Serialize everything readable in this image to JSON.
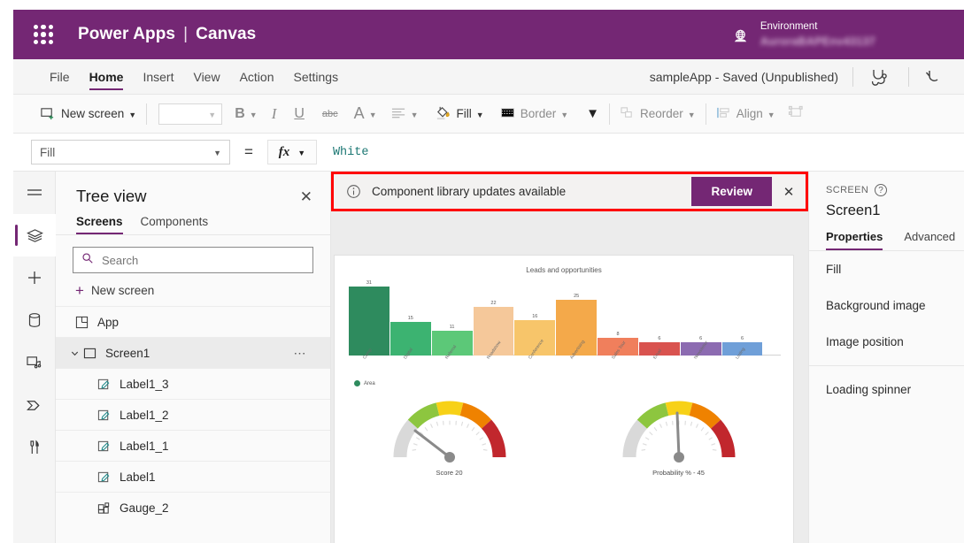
{
  "titlebar": {
    "waffle_icon": "waffle-grid-icon",
    "brand": "Power Apps",
    "brand_separator": "|",
    "brand_suffix": "Canvas",
    "environment_label": "Environment",
    "environment_name": "AuroraBAPEnv43137",
    "globe_icon": "globe-icon"
  },
  "menubar": {
    "items": [
      {
        "label": "File",
        "active": false
      },
      {
        "label": "Home",
        "active": true
      },
      {
        "label": "Insert",
        "active": false
      },
      {
        "label": "View",
        "active": false
      },
      {
        "label": "Action",
        "active": false
      },
      {
        "label": "Settings",
        "active": false
      }
    ],
    "app_status": "sampleApp - Saved (Unpublished)",
    "checker_icon": "app-checker-stethoscope-icon",
    "undo_icon": "undo-arrow-icon"
  },
  "ribbon": {
    "new_screen": "New screen",
    "font_select_value": "",
    "bold": "B",
    "italic": "I",
    "underline": "U",
    "strikethrough": "abc",
    "font_color": "A",
    "align": "align-icon",
    "fill": "Fill",
    "border": "Border",
    "more_chevron": "chevron-down-icon",
    "reorder": "Reorder",
    "align_label": "Align",
    "group": "group-icon"
  },
  "formulabar": {
    "property": "Fill",
    "equals": "=",
    "fx": "fx",
    "value": "White"
  },
  "rail": {
    "items": [
      {
        "name": "hamburger-menu-icon",
        "selected": false
      },
      {
        "name": "tree-view-layers-icon",
        "selected": true
      },
      {
        "name": "insert-plus-icon",
        "selected": false
      },
      {
        "name": "data-sources-icon",
        "selected": false
      },
      {
        "name": "media-icon",
        "selected": false
      },
      {
        "name": "power-automate-icon",
        "selected": false
      },
      {
        "name": "advanced-tools-icon",
        "selected": false
      }
    ]
  },
  "treeview": {
    "title": "Tree view",
    "close_icon": "close-icon",
    "tabs": [
      {
        "label": "Screens",
        "active": true
      },
      {
        "label": "Components",
        "active": false
      }
    ],
    "search_placeholder": "Search",
    "search_icon": "search-icon",
    "new_screen": "New screen",
    "rows": [
      {
        "label": "App",
        "icon": "app-icon",
        "indent": 0,
        "selected": false,
        "expander": "",
        "menu": false
      },
      {
        "label": "Screen1",
        "icon": "screen-icon",
        "indent": 0,
        "selected": true,
        "expander": "chevron-down-icon",
        "menu": true
      },
      {
        "label": "Label1_3",
        "icon": "label-icon",
        "indent": 1,
        "selected": false,
        "expander": "",
        "menu": false
      },
      {
        "label": "Label1_2",
        "icon": "label-icon",
        "indent": 1,
        "selected": false,
        "expander": "",
        "menu": false
      },
      {
        "label": "Label1_1",
        "icon": "label-icon",
        "indent": 1,
        "selected": false,
        "expander": "",
        "menu": false
      },
      {
        "label": "Label1",
        "icon": "label-icon",
        "indent": 1,
        "selected": false,
        "expander": "",
        "menu": false
      },
      {
        "label": "Gauge_2",
        "icon": "gauge-control-icon",
        "indent": 1,
        "selected": false,
        "expander": "",
        "menu": false
      }
    ]
  },
  "notification": {
    "info_icon": "info-circle-icon",
    "message": "Component library updates available",
    "review_label": "Review",
    "close_icon": "close-icon",
    "highlight_color": "#ff0000",
    "accent_color": "#742774"
  },
  "properties_panel": {
    "kicker": "SCREEN",
    "help_icon": "help-circle-icon",
    "name": "Screen1",
    "tabs": [
      {
        "label": "Properties",
        "active": true
      },
      {
        "label": "Advanced",
        "active": false
      }
    ],
    "group1": [
      "Fill",
      "Background image",
      "Image position"
    ],
    "group2": [
      "Loading spinner"
    ]
  },
  "chart_data": [
    {
      "type": "bar",
      "title": "Leads and opportunities",
      "categories": [
        "Camp",
        "Digital",
        "Referral",
        "Roadshow",
        "Conference",
        "Advertising",
        "Sales Tour",
        "Email",
        "Newsletter",
        "Listing"
      ],
      "values": [
        31,
        15,
        11,
        22,
        16,
        25,
        8,
        6,
        6,
        6
      ],
      "colors": [
        "#2e8b5e",
        "#3cb371",
        "#5cc878",
        "#f5c89a",
        "#f7c56a",
        "#f4a94a",
        "#f07f5c",
        "#d9534f",
        "#8c6bb1",
        "#6f9fd8"
      ],
      "legend": [
        "Area"
      ],
      "legend_position": "bottom-left",
      "xlabel": "",
      "ylabel": "",
      "ylim": [
        0,
        31
      ],
      "grid": false
    },
    {
      "type": "gauge",
      "title": "Score",
      "label": "Score    20",
      "value": 20,
      "min": 0,
      "max": 100,
      "bands": [
        "#d9d9d9",
        "#8dc63f",
        "#f7d117",
        "#ef8200",
        "#c1272d"
      ]
    },
    {
      "type": "gauge",
      "title": "Probability %",
      "label": "Probability % -  45",
      "value": 45,
      "min": 0,
      "max": 100,
      "bands": [
        "#d9d9d9",
        "#8dc63f",
        "#f7d117",
        "#ef8200",
        "#c1272d"
      ]
    }
  ]
}
